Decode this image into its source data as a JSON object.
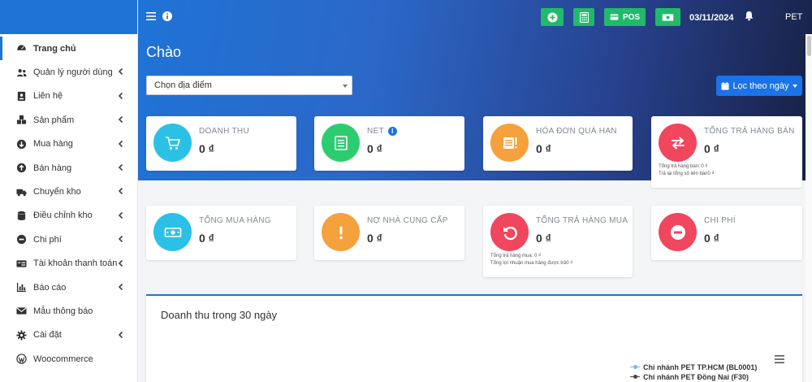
{
  "colors": {
    "primary": "#1f73d6",
    "green": "#21b96a",
    "cyan": "#2bc1e6",
    "success": "#2ecc71",
    "orange": "#f5a13d",
    "red": "#f0465e"
  },
  "sidebar": {
    "items": [
      {
        "label": "Trang chủ",
        "icon": "dashboard-icon",
        "chevron": false
      },
      {
        "label": "Quản lý người dùng",
        "icon": "users-icon",
        "chevron": true
      },
      {
        "label": "Liên hệ",
        "icon": "contact-card-icon",
        "chevron": true
      },
      {
        "label": "Sản phẩm",
        "icon": "cubes-icon",
        "chevron": true
      },
      {
        "label": "Mua hàng",
        "icon": "arrow-circle-down-icon",
        "chevron": true
      },
      {
        "label": "Bán hàng",
        "icon": "arrow-circle-up-icon",
        "chevron": true
      },
      {
        "label": "Chuyển kho",
        "icon": "truck-icon",
        "chevron": true
      },
      {
        "label": "Điều chỉnh kho",
        "icon": "database-icon",
        "chevron": true
      },
      {
        "label": "Chi phí",
        "icon": "minus-circle-icon",
        "chevron": true
      },
      {
        "label": "Tài khoản thanh toán",
        "icon": "money-check-icon",
        "chevron": true
      },
      {
        "label": "Báo cáo",
        "icon": "bar-chart-icon",
        "chevron": true
      },
      {
        "label": "Mẫu thông báo",
        "icon": "envelope-icon",
        "chevron": false
      },
      {
        "label": "Cài đặt",
        "icon": "gear-icon",
        "chevron": true
      },
      {
        "label": "Woocommerce",
        "icon": "wordpress-icon",
        "chevron": false
      }
    ]
  },
  "header": {
    "pos_label": "POS",
    "date": "03/11/2024",
    "user": "PET"
  },
  "main": {
    "greeting": "Chào",
    "location_select": "Chọn địa điểm",
    "filter_button": "Lọc theo ngày"
  },
  "cards": {
    "revenue": {
      "label": "DOANH THU",
      "value": "0 ₫"
    },
    "net": {
      "label": "NET",
      "value": "0 ₫"
    },
    "overdue": {
      "label": "HÓA ĐƠN QUÁ HẠN",
      "value": "0 ₫"
    },
    "sales_return": {
      "label": "TỔNG TRẢ HÀNG BÁN",
      "value": "0 ₫",
      "note1": "Tổng trả hàng bán: 0 ₫",
      "note2": "Trả lại tổng số liên bán0 ₫"
    },
    "purchase": {
      "label": "TỔNG MUA HÀNG",
      "value": "0 ₫"
    },
    "supplier_debt": {
      "label": "NỢ NHÀ CUNG CẤP",
      "value": "0 ₫"
    },
    "purchase_return": {
      "label": "TỔNG TRẢ HÀNG MUA",
      "value": "0 ₫",
      "note1": "Tổng trả hàng mua: 0 ₫",
      "note2": "Tổng lợi nhuận mua hàng được trả0 ₫"
    },
    "expense": {
      "label": "CHI PHÍ",
      "value": "0 ₫"
    }
  },
  "chart": {
    "title": "Doanh thu trong 30 ngày",
    "legend": [
      {
        "name": "Chi nhánh PET TP.HCM (BL0001)",
        "color": "#7cb5ec"
      },
      {
        "name": "Chi nhánh PET Đồng Nai (F30)",
        "color": "#434348"
      }
    ]
  }
}
